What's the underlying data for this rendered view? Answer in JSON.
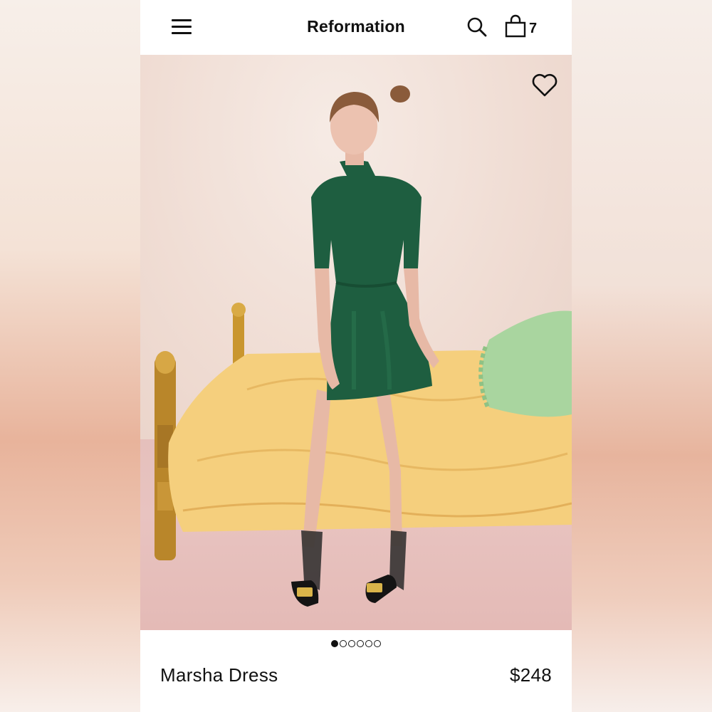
{
  "header": {
    "brand": "Reformation",
    "cart_count": "7"
  },
  "icons": {
    "menu": "hamburger-menu-icon",
    "search": "search-icon",
    "bag": "shopping-bag-icon",
    "favorite": "heart-icon"
  },
  "gallery": {
    "image_count": 6,
    "active_index": 0
  },
  "product": {
    "name": "Marsha Dress",
    "price": "$248"
  },
  "colors": {
    "text": "#111111",
    "background": "#ffffff",
    "dress": "#1e5e40",
    "bedspread": "#f5cf7d",
    "pillow": "#a9d59f",
    "wall": "#f0ddd4",
    "carpet": "#e5c0bc"
  }
}
